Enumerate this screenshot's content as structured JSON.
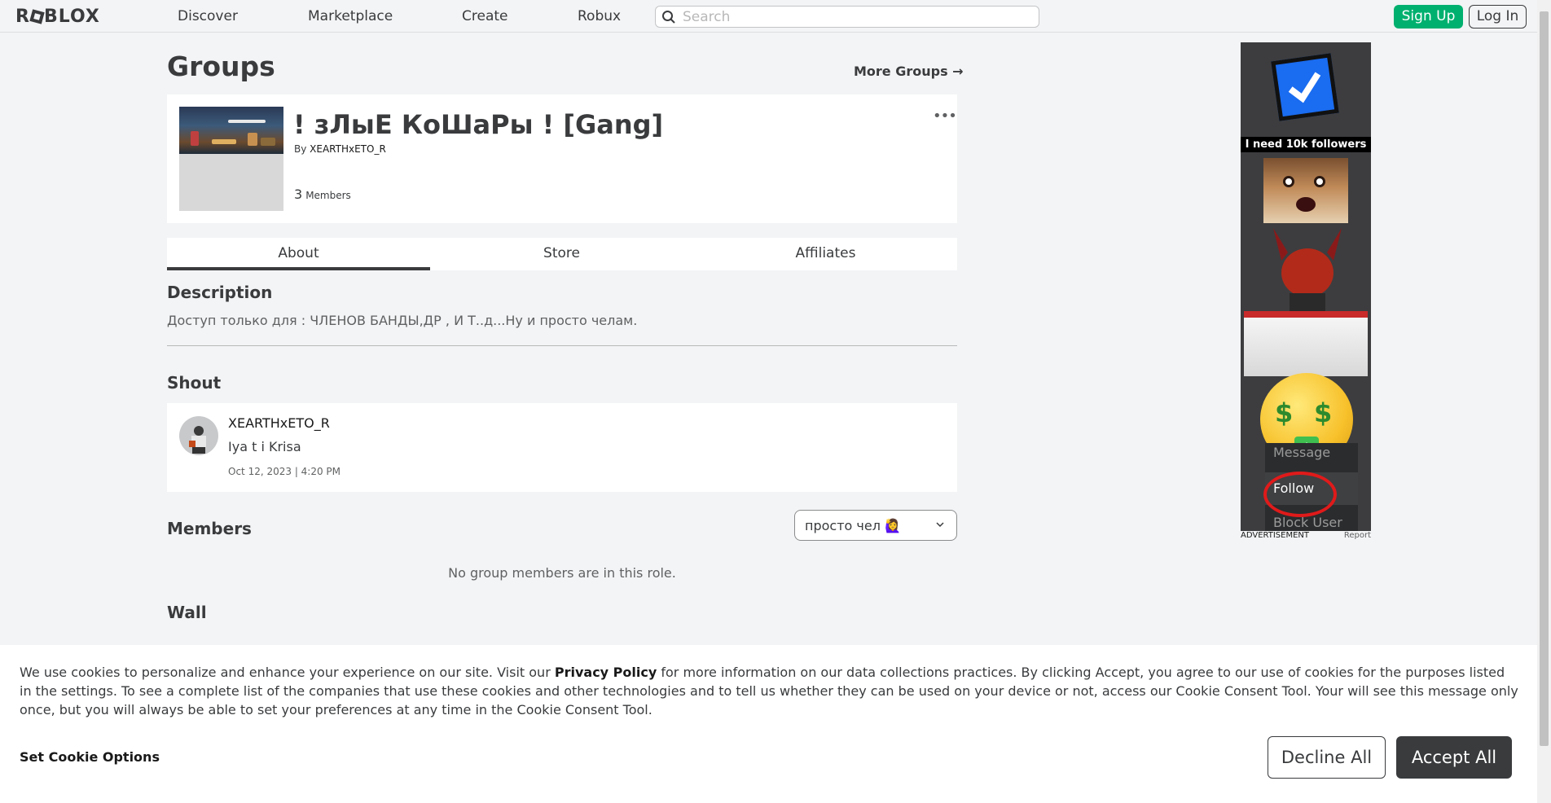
{
  "nav": {
    "logo": "ROBLOX",
    "links": [
      "Discover",
      "Marketplace",
      "Create",
      "Robux"
    ],
    "search_placeholder": "Search",
    "signup": "Sign Up",
    "login": "Log In"
  },
  "page": {
    "title": "Groups",
    "more_groups": "More Groups →"
  },
  "group": {
    "name": "! зЛыЕ КоШаРы ! [Gang]",
    "by_prefix": "By",
    "owner": "XEARTHxETO_R",
    "member_count": "3",
    "members_label": "Members",
    "menu_icon": "ellipsis-icon"
  },
  "tabs": [
    "About",
    "Store",
    "Affiliates"
  ],
  "description": {
    "heading": "Description",
    "text": "Доступ только для : ЧЛЕНОВ БАНДЫ,ДР , И Т..д...Ну и просто челам."
  },
  "shout": {
    "heading": "Shout",
    "user": "XEARTHxETO_R",
    "text": "Iya t i Krisa",
    "date": "Oct 12, 2023 | 4:20 PM"
  },
  "members": {
    "heading": "Members",
    "role_selected": "просто чел 🙋‍♀️",
    "empty": "No group members are in this role."
  },
  "wall": {
    "heading": "Wall"
  },
  "ad": {
    "headline": "I need 10k followers",
    "menu": [
      "Message",
      "Follow",
      "Block User"
    ],
    "label": "ADVERTISEMENT",
    "report": "Report"
  },
  "cookie": {
    "text_before": "We use cookies to personalize and enhance your experience on our site. Visit our ",
    "link": "Privacy Policy",
    "text_after": " for more information on our data collections practices. By clicking Accept, you agree to our use of cookies for the purposes listed in the settings. To see a complete list of the companies that use these cookies and other technologies and to tell us whether they can be used on your device or not, access our Cookie Consent Tool. Your will see this message only once, but you will always be able to set your preferences at any time in the Cookie Consent Tool.",
    "options": "Set Cookie Options",
    "decline": "Decline All",
    "accept": "Accept All"
  },
  "colors": {
    "signup_green": "#00b06f",
    "accent_dark": "#393b3d",
    "page_bg": "#f2f4f5",
    "highlight_red": "#e01a1a"
  }
}
